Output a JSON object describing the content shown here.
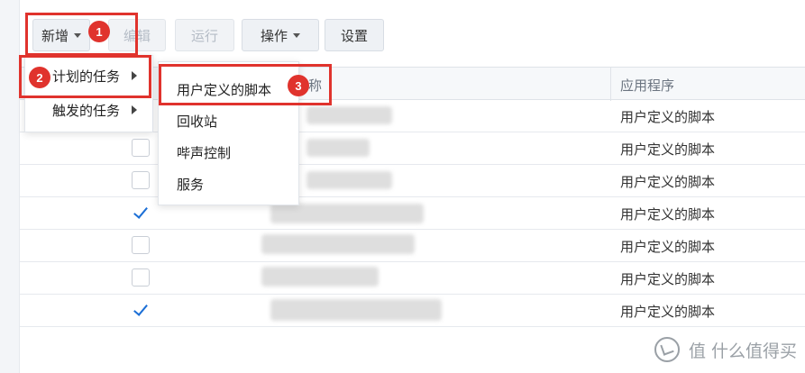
{
  "toolbar": {
    "add_label": "新增",
    "edit_label": "编辑",
    "run_label": "运行",
    "action_label": "操作",
    "settings_label": "设置"
  },
  "grid": {
    "header_name_partial": "称",
    "header_app": "应用程序",
    "rows": [
      {
        "checked": null,
        "app": "用户定义的脚本"
      },
      {
        "checked": false,
        "app": "用户定义的脚本"
      },
      {
        "checked": false,
        "app": "用户定义的脚本"
      },
      {
        "checked": true,
        "app": "用户定义的脚本"
      },
      {
        "checked": false,
        "app": "用户定义的脚本"
      },
      {
        "checked": false,
        "app": "用户定义的脚本"
      },
      {
        "checked": true,
        "app": "用户定义的脚本"
      }
    ]
  },
  "menu_add": {
    "items": [
      {
        "label": "计划的任务"
      },
      {
        "label": "触发的任务"
      }
    ]
  },
  "submenu_scheduled": {
    "items": [
      {
        "label": "用户定义的脚本"
      },
      {
        "label": "回收站"
      },
      {
        "label": "哔声控制"
      },
      {
        "label": "服务"
      }
    ]
  },
  "annotations": {
    "badge_1": "1",
    "badge_2": "2",
    "badge_3": "3",
    "color": "#e0332d"
  },
  "watermark": {
    "text": "值 什么值得买"
  }
}
